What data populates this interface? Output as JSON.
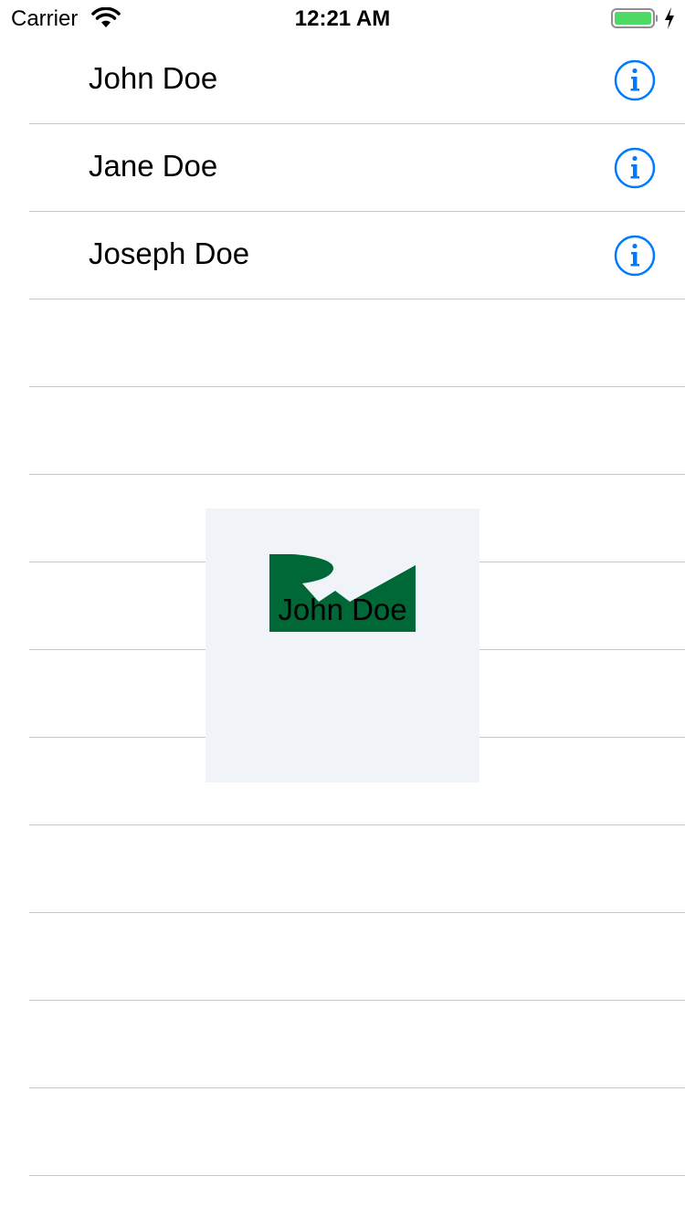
{
  "status_bar": {
    "carrier": "Carrier",
    "time": "12:21 AM",
    "wifi_icon": "wifi-icon",
    "battery_icon": "battery-charging-icon",
    "battery_color": "#4cd964"
  },
  "contacts": [
    {
      "name": "John Doe",
      "icon": "info-icon"
    },
    {
      "name": "Jane Doe",
      "icon": "info-icon"
    },
    {
      "name": "Joseph Doe",
      "icon": "info-icon"
    }
  ],
  "accent_color": "#007aff",
  "popup": {
    "name": "John Doe",
    "image_icon": "contact-photo-placeholder",
    "background": "#f0f3f8",
    "image_color": "#006837"
  }
}
